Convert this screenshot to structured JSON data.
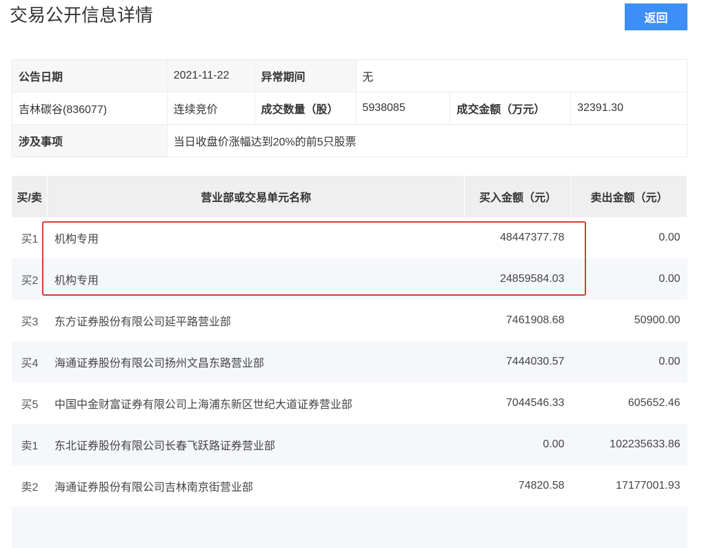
{
  "header": {
    "title": "交易公开信息详情",
    "back_label": "返回"
  },
  "info": {
    "announce_date_label": "公告日期",
    "announce_date": "2021-11-22",
    "abnormal_period_label": "异常期间",
    "abnormal_period": "无",
    "stock": "吉林碳谷(836077)",
    "trade_type": "连续竞价",
    "volume_label": "成交数量（股）",
    "volume": "5938085",
    "amount_label": "成交金额（万元）",
    "amount": "32391.30",
    "matter_label": "涉及事项",
    "matter": "当日收盘价涨幅达到20%的前5只股票"
  },
  "trades": {
    "columns": [
      "买/卖",
      "营业部或交易单元名称",
      "买入金额（元）",
      "卖出金额（元）"
    ],
    "rows": [
      {
        "side": "买1",
        "name": "机构专用",
        "buy": "48447377.78",
        "sell": "0.00"
      },
      {
        "side": "买2",
        "name": "机构专用",
        "buy": "24859584.03",
        "sell": "0.00"
      },
      {
        "side": "买3",
        "name": "东方证券股份有限公司延平路营业部",
        "buy": "7461908.68",
        "sell": "50900.00"
      },
      {
        "side": "买4",
        "name": "海通证券股份有限公司扬州文昌东路营业部",
        "buy": "7444030.57",
        "sell": "0.00"
      },
      {
        "side": "买5",
        "name": "中国中金财富证券有限公司上海浦东新区世纪大道证券营业部",
        "buy": "7044546.33",
        "sell": "605652.46"
      },
      {
        "side": "卖1",
        "name": "东北证券股份有限公司长春飞跃路证券营业部",
        "buy": "0.00",
        "sell": "102235633.86"
      },
      {
        "side": "卖2",
        "name": "海通证券股份有限公司吉林南京街营业部",
        "buy": "74820.58",
        "sell": "17177001.93"
      },
      {
        "side": "",
        "name": "",
        "buy": "",
        "sell": ""
      }
    ]
  },
  "colors": {
    "accent": "#3e8ef7",
    "highlight": "#d93a32"
  }
}
